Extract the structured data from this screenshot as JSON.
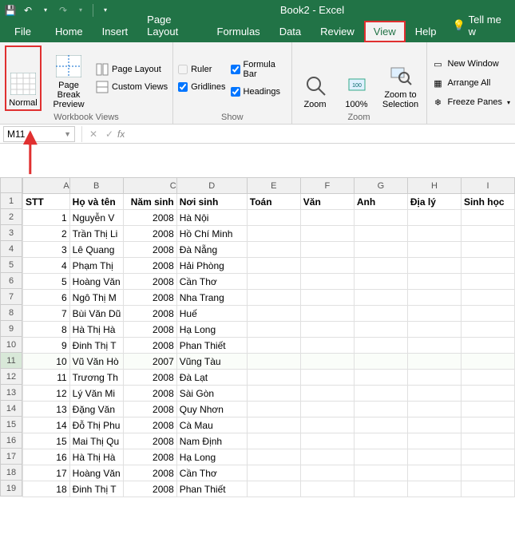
{
  "title": "Book2  -  Excel",
  "qat": {
    "save": "💾",
    "undo": "↶",
    "redo": "↷"
  },
  "tabs": {
    "file": "File",
    "home": "Home",
    "insert": "Insert",
    "page_layout": "Page Layout",
    "formulas": "Formulas",
    "data": "Data",
    "review": "Review",
    "view": "View",
    "help": "Help",
    "tell_me": "Tell me w"
  },
  "ribbon": {
    "workbook_views": {
      "label": "Workbook Views",
      "normal": "Normal",
      "page_break": "Page Break\nPreview",
      "page_layout": "Page Layout",
      "custom_views": "Custom Views"
    },
    "show": {
      "label": "Show",
      "ruler": "Ruler",
      "gridlines": "Gridlines",
      "formula_bar": "Formula Bar",
      "headings": "Headings"
    },
    "zoom": {
      "label": "Zoom",
      "zoom": "Zoom",
      "hundred": "100%",
      "zoom_sel": "Zoom to\nSelection"
    },
    "window": {
      "new_window": "New Window",
      "arrange_all": "Arrange All",
      "freeze": "Freeze Panes"
    }
  },
  "namebox": "M11",
  "columns": [
    "A",
    "B",
    "C",
    "D",
    "E",
    "F",
    "G",
    "H",
    "I"
  ],
  "header_row": [
    "STT",
    "Họ và tên",
    "Năm sinh",
    "Nơi sinh",
    "Toán",
    "Văn",
    "Anh",
    "Địa lý",
    "Sinh học"
  ],
  "rows": [
    {
      "n": 1,
      "stt": 1,
      "name": "Nguyễn V",
      "year": 2008,
      "place": "Hà Nội"
    },
    {
      "n": 2,
      "stt": 2,
      "name": "Trần Thị Li",
      "year": 2008,
      "place": "Hồ Chí Minh"
    },
    {
      "n": 3,
      "stt": 3,
      "name": "Lê Quang",
      "year": 2008,
      "place": "Đà Nẵng"
    },
    {
      "n": 4,
      "stt": 4,
      "name": "Phạm Thị",
      "year": 2008,
      "place": "Hải Phòng"
    },
    {
      "n": 5,
      "stt": 5,
      "name": "Hoàng Văn",
      "year": 2008,
      "place": "Cần Thơ"
    },
    {
      "n": 6,
      "stt": 6,
      "name": "Ngô Thị M",
      "year": 2008,
      "place": "Nha Trang"
    },
    {
      "n": 7,
      "stt": 7,
      "name": "Bùi Văn Dũ",
      "year": 2008,
      "place": "Huế"
    },
    {
      "n": 8,
      "stt": 8,
      "name": "Hà Thị Hà",
      "year": 2008,
      "place": "Hạ Long"
    },
    {
      "n": 9,
      "stt": 9,
      "name": "Đinh Thị T",
      "year": 2008,
      "place": "Phan Thiết"
    },
    {
      "n": 10,
      "stt": 10,
      "name": "Vũ Văn Hò",
      "year": 2007,
      "place": "Vũng Tàu"
    },
    {
      "n": 11,
      "stt": 11,
      "name": "Trương Th",
      "year": 2008,
      "place": "Đà Lạt"
    },
    {
      "n": 12,
      "stt": 12,
      "name": "Lý Văn Mi",
      "year": 2008,
      "place": "Sài Gòn"
    },
    {
      "n": 13,
      "stt": 13,
      "name": "Đặng Văn",
      "year": 2008,
      "place": "Quy Nhơn"
    },
    {
      "n": 14,
      "stt": 14,
      "name": "Đỗ Thị Phu",
      "year": 2008,
      "place": "Cà Mau"
    },
    {
      "n": 15,
      "stt": 15,
      "name": "Mai Thị Qu",
      "year": 2008,
      "place": "Nam Định"
    },
    {
      "n": 16,
      "stt": 16,
      "name": "Hà Thị Hà",
      "year": 2008,
      "place": "Hạ Long"
    },
    {
      "n": 17,
      "stt": 17,
      "name": "Hoàng Văn",
      "year": 2008,
      "place": "Cần Thơ"
    },
    {
      "n": 18,
      "stt": 18,
      "name": "Đinh Thị T",
      "year": 2008,
      "place": "Phan Thiết"
    }
  ],
  "selected_row": 11
}
